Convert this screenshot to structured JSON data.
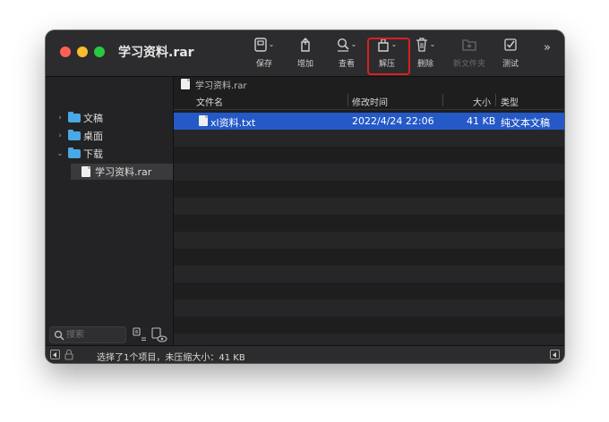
{
  "window": {
    "title": "学习资料.rar"
  },
  "toolbar": {
    "save": "保存",
    "add": "增加",
    "view": "查看",
    "extract": "解压",
    "delete": "删除",
    "new_folder": "新文件夹",
    "test": "测试",
    "more": "»"
  },
  "sidebar": {
    "items": [
      {
        "label": "文稿",
        "icon": "folder-icon",
        "expanded": false
      },
      {
        "label": "桌面",
        "icon": "folder-icon",
        "expanded": false
      },
      {
        "label": "下载",
        "icon": "folder-icon",
        "expanded": true
      },
      {
        "label": "学习资料.rar",
        "icon": "archive-icon",
        "selected": true
      }
    ],
    "search_placeholder": "搜索"
  },
  "breadcrumb": {
    "label": "学习资料.rar"
  },
  "columns": {
    "name": "文件名",
    "modified": "修改时间",
    "size": "大小",
    "kind": "类型"
  },
  "files": [
    {
      "name": "xl资料.txt",
      "modified": "2022/4/24 22:06",
      "size": "41 KB",
      "kind": "纯文本文稿",
      "selected": true
    }
  ],
  "status": {
    "text": "选择了1个项目，未压缩大小：41 KB"
  },
  "colors": {
    "selection": "#2459c7",
    "highlight_box": "#d92020",
    "folder": "#4aa8e6"
  }
}
